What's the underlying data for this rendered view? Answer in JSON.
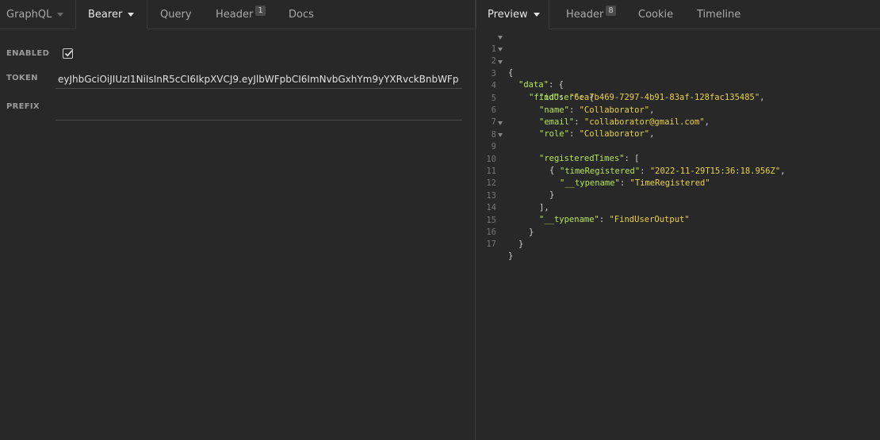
{
  "left_tabs": [
    {
      "label": "GraphQL"
    },
    {
      "label": "Bearer"
    },
    {
      "label": "Query"
    },
    {
      "label": "Header",
      "badge": "1"
    },
    {
      "label": "Docs"
    }
  ],
  "auth": {
    "enabled_label": "ENABLED",
    "enabled": true,
    "token_label": "TOKEN",
    "token_value": "eyJhbGciOiJIUzI1NiIsInR5cCI6IkpXVCJ9.eyJlbWFpbCI6ImNvbGxhYm9yYXRvckBnbWFp",
    "prefix_label": "PREFIX",
    "prefix_value": ""
  },
  "right_tabs": [
    {
      "label": "Preview"
    },
    {
      "label": "Header",
      "badge": "8"
    },
    {
      "label": "Cookie"
    },
    {
      "label": "Timeline"
    }
  ],
  "response": {
    "line_numbers": [
      "1",
      "2",
      "3",
      "4",
      "5",
      "6",
      "7",
      "8",
      "9",
      "10",
      "11",
      "12",
      "13",
      "14",
      "15",
      "16",
      "17"
    ],
    "data_key": "\"data\"",
    "finduser_key": "\"findUser\"",
    "id_key": "\"id\"",
    "id_val": "\"6ea7b469-7297-4b91-83af-128fac135485\"",
    "name_key": "\"name\"",
    "name_val": "\"Collaborator\"",
    "email_key": "\"email\"",
    "email_val": "\"collaborator@gmail.com\"",
    "role_key": "\"role\"",
    "role_val": "\"Collaborator\"",
    "regtimes_key": "\"registeredTimes\"",
    "timereg_key": "\"timeRegistered\"",
    "timereg_val": "\"2022-11-29T15:36:18.956Z\"",
    "typename_key": "\"__typename\"",
    "typename_inner_val": "\"TimeRegistered\"",
    "typename_outer_val": "\"FindUserOutput\""
  },
  "colors": {
    "background": "#282828",
    "json_key": "#b6e35a",
    "json_string": "#e8d24a"
  }
}
